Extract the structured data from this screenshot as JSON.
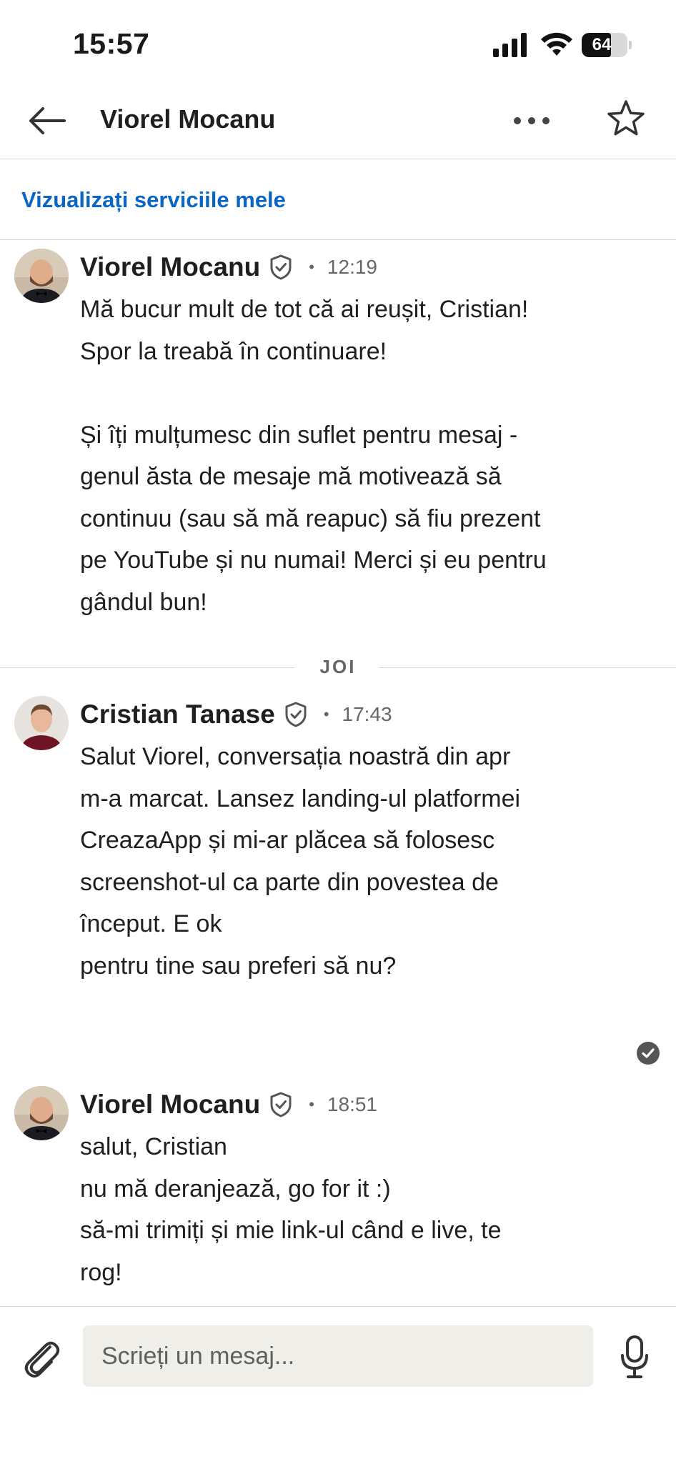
{
  "status_bar": {
    "time": "15:57",
    "battery_level": 64,
    "battery_label": "64"
  },
  "header": {
    "title": "Viorel Mocanu"
  },
  "services_link": "Vizualizați serviciile mele",
  "messages": [
    {
      "sender": "Viorel Mocanu",
      "time": "12:19",
      "body": "Mă bucur mult de tot că ai reușit, Cristian!\nSpor la treabă în continuare!\n\nȘi îți mulțumesc din suflet pentru mesaj -\ngenul ăsta de mesaje mă motivează să\ncontinuu (sau să mă reapuc) să fiu prezent\npe YouTube și nu numai! Merci și eu pentru\ngândul bun!"
    },
    {
      "sender": "Cristian Tanase",
      "time": "17:43",
      "body": "Salut Viorel, conversația noastră din apr\nm-a marcat. Lansez landing-ul platformei\nCreazaApp și mi-ar plăcea să folosesc\nscreenshot-ul ca parte din povestea de\nînceput. E ok\n   pentru tine sau preferi să nu?"
    },
    {
      "sender": "Viorel Mocanu",
      "time": "18:51",
      "body": "salut, Cristian\nnu mă deranjează, go for it :)\nsă-mi trimiți și mie link-ul când e live, te\nrog!"
    }
  ],
  "day_divider": "JOI",
  "composer": {
    "placeholder": "Scrieți un mesaj..."
  },
  "icons": {
    "back": "arrow-left-icon",
    "more": "more-horizontal-icon",
    "star": "star-outline-icon",
    "verified": "verified-shield-icon",
    "read": "check-circle-icon",
    "attach": "paperclip-icon",
    "mic": "microphone-icon"
  },
  "colors": {
    "link": "#0a66c2",
    "composer_bg": "#f0eee9",
    "text": "#1f1f1f",
    "muted": "#666666"
  }
}
